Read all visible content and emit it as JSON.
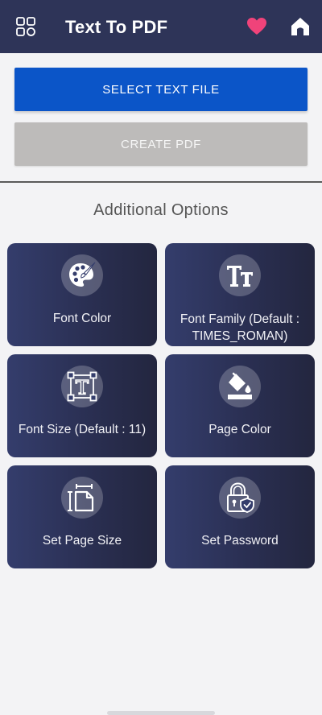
{
  "header": {
    "title": "Text To PDF",
    "icons": {
      "menu": "grid-icon",
      "favorite": "heart-icon",
      "home": "home-icon"
    },
    "colors": {
      "bar": "#2e3458",
      "heart": "#f0437a"
    }
  },
  "actions": {
    "select_label": "SELECT TEXT FILE",
    "create_label": "CREATE PDF"
  },
  "options": {
    "title": "Additional Options",
    "cards": [
      {
        "label": "Font Color",
        "icon": "palette-icon"
      },
      {
        "label": "Font Family (Default : TIMES_ROMAN)",
        "icon": "font-family-icon"
      },
      {
        "label": "Font Size (Default : 11)",
        "icon": "font-size-icon"
      },
      {
        "label": "Page Color",
        "icon": "paint-bucket-icon"
      },
      {
        "label": "Set Page Size",
        "icon": "page-size-icon"
      },
      {
        "label": "Set Password",
        "icon": "lock-shield-icon"
      }
    ]
  },
  "colors": {
    "primary_button": "#0b55c8",
    "disabled_button": "#bdbbba",
    "card_gradient_start": "#343d6c",
    "card_gradient_end": "#23263f"
  }
}
